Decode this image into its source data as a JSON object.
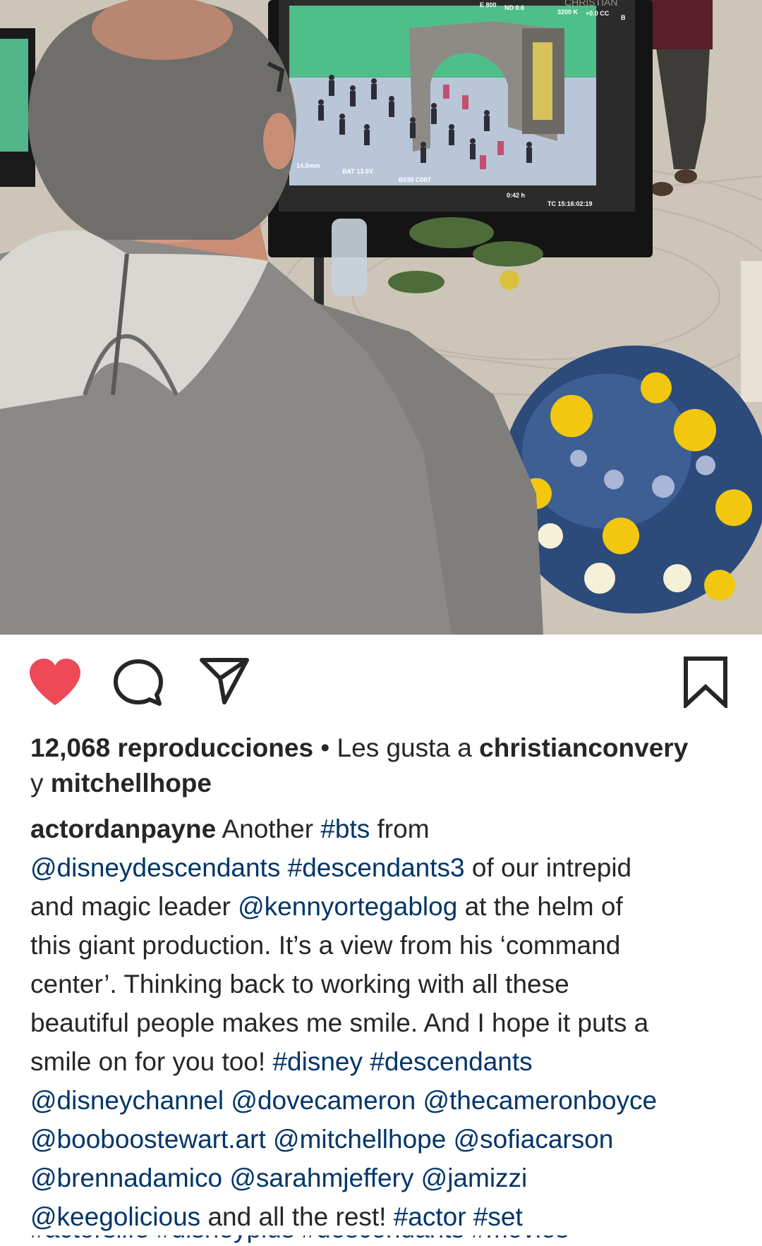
{
  "post": {
    "views_count": "12,068 reproducciones",
    "separator": " • ",
    "liked_by_prefix": "Les gusta a ",
    "liked_by_user1": "christianconvery",
    "liked_by_conjunction": "y ",
    "liked_by_user2": "mitchellhope",
    "username": "actordanpayne",
    "caption": {
      "l1_text": " Another ",
      "l1_tag": "#bts",
      "l1_end": " from",
      "l2_mention": "@disneydescendants",
      "l2_space": " ",
      "l2_tag": "#descendants3",
      "l2_end": " of our intrepid",
      "l3_start": "and magic leader ",
      "l3_mention": "@kennyortegablog",
      "l3_end": " at the helm of",
      "l4": "this giant production. It’s a view from his ‘command",
      "l5": "center’. Thinking back to working with all these",
      "l6": "beautiful people makes me smile. And I hope it puts a",
      "l7_start": "smile on for you too! ",
      "l7_tag1": "#disney",
      "l7_space": " ",
      "l7_tag2": "#descendants",
      "l8_m1": "@disneychannel",
      "l8_m2": "@dovecameron",
      "l8_m3": "@thecameronboyce",
      "l9_m1": "@booboostewart.art",
      "l9_m2": "@mitchellhope",
      "l9_m3": "@sofiacarson",
      "l10_m1": "@brennadamico",
      "l10_m2": "@sarahmjeffery",
      "l10_m3": "@jamizzi",
      "l11_m1": "@keegolicious",
      "l11_text": " and all the rest! ",
      "l11_tag1": "#actor",
      "l11_space": " ",
      "l11_tag2": "#set",
      "l12_partial": "#actorslife #disneyplus #descendants #movies"
    },
    "space": " "
  },
  "monitor": {
    "osd_top_1": "E 800",
    "osd_top_2": "ND 0.6",
    "osd_top_3": "3200 K",
    "osd_top_4": "+0.0 CC",
    "osd_top_5": "B",
    "osd_bottom_1": "14.0mm",
    "osd_bottom_2": "BAT 13.6V",
    "osd_bottom_3": "B039 C007",
    "osd_bottom_4": "0:42 h",
    "osd_timecode": "TC 15:16:02:19",
    "banner": "CHRISTIAN"
  },
  "colors": {
    "heart": "#ed4956",
    "link": "#003569",
    "text": "#262626"
  },
  "icons": {
    "like": "heart-icon",
    "comment": "comment-icon",
    "share": "paper-plane-icon",
    "save": "bookmark-icon"
  }
}
